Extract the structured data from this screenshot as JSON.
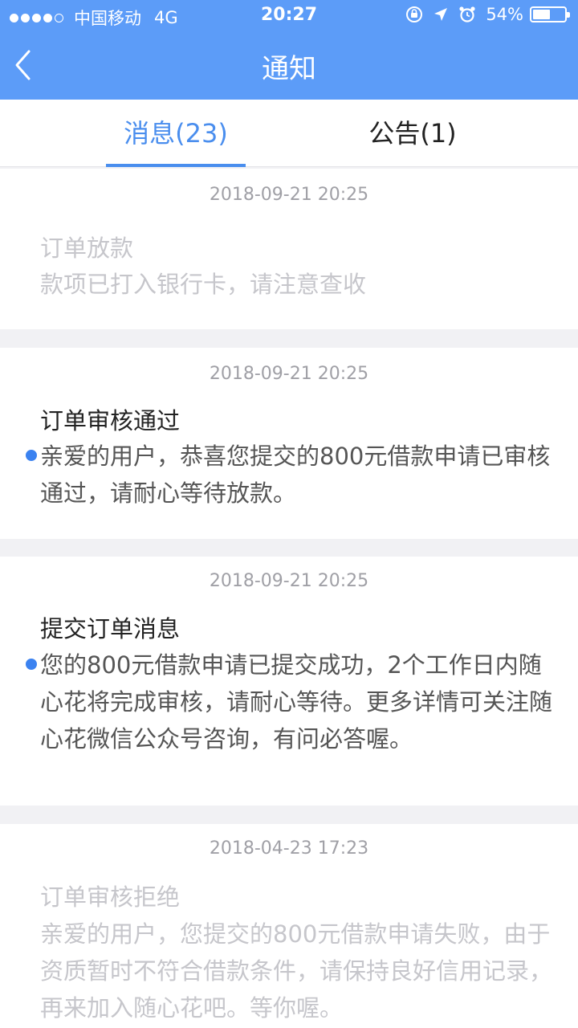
{
  "status_bar": {
    "carrier": "中国移动",
    "network": "4G",
    "time": "20:27",
    "battery_percent_text": "54%",
    "battery_level": 0.54
  },
  "nav": {
    "title": "通知",
    "back_icon": "chevron-left-icon"
  },
  "tabs": [
    {
      "label": "消息(23)",
      "active": true
    },
    {
      "label": "公告(1)",
      "active": false
    }
  ],
  "notifications": [
    {
      "time": "2018-09-21 20:25",
      "title": "订单放款",
      "body": "款项已打入银行卡，请注意查收",
      "unread": false
    },
    {
      "time": "2018-09-21 20:25",
      "title": "订单审核通过",
      "body": "亲爱的用户，恭喜您提交的800元借款申请已审核通过，请耐心等待放款。",
      "unread": true
    },
    {
      "time": "2018-09-21 20:25",
      "title": "提交订单消息",
      "body": "您的800元借款申请已提交成功，2个工作日内随心花将完成审核，请耐心等待。更多详情可关注随心花微信公众号咨询，有问必答喔。",
      "unread": true
    },
    {
      "time": "2018-04-23 17:23",
      "title": "订单审核拒绝",
      "body": "亲爱的用户，您提交的800元借款申请失败，由于资质暂时不符合借款条件，请保持良好信用记录，再来加入随心花吧。等你喔。",
      "unread": false
    }
  ],
  "colors": {
    "header": "#5c9cf8",
    "accent": "#4a8eee",
    "unread_dot": "#3b82f0",
    "divider": "#f1f1f4"
  }
}
